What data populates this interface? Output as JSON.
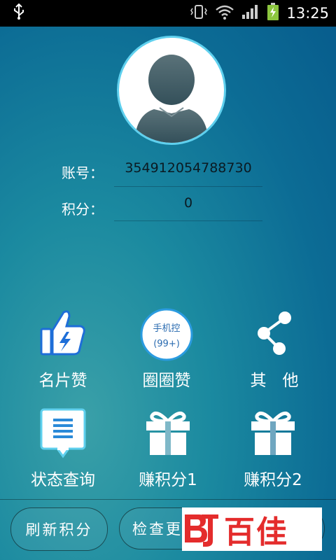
{
  "status_bar": {
    "time": "13:25",
    "icons": [
      "usb-icon",
      "vibrate-icon",
      "wifi-icon",
      "signal-icon",
      "battery-charging-icon"
    ]
  },
  "profile": {
    "avatar": "default-user-avatar",
    "account_label": "账号：",
    "account_value": "354912054788730",
    "points_label": "积分：",
    "points_value": "0"
  },
  "grid": [
    {
      "label": "名片赞",
      "icon": "thumbs-up-icon"
    },
    {
      "label": "圈圈赞",
      "icon": "phone-control-badge-icon",
      "badge_line1": "手机控",
      "badge_line2": "(99+)"
    },
    {
      "label": "其　他",
      "icon": "share-icon"
    },
    {
      "label": "状态查询",
      "icon": "status-list-icon"
    },
    {
      "label": "赚积分1",
      "icon": "gift-icon"
    },
    {
      "label": "赚积分2",
      "icon": "gift-icon"
    }
  ],
  "bottom": {
    "refresh_button": "刷新积分",
    "update_button": "检查更"
  },
  "watermark": {
    "text": "百佳",
    "logo": "BJ-logo"
  },
  "colors": {
    "background_start": "#3aa0a8",
    "background_end": "#075b8c",
    "avatar_ring": "#5fd0ee",
    "icon_blue": "#1e6ed8",
    "watermark_red": "#e42c2c"
  }
}
